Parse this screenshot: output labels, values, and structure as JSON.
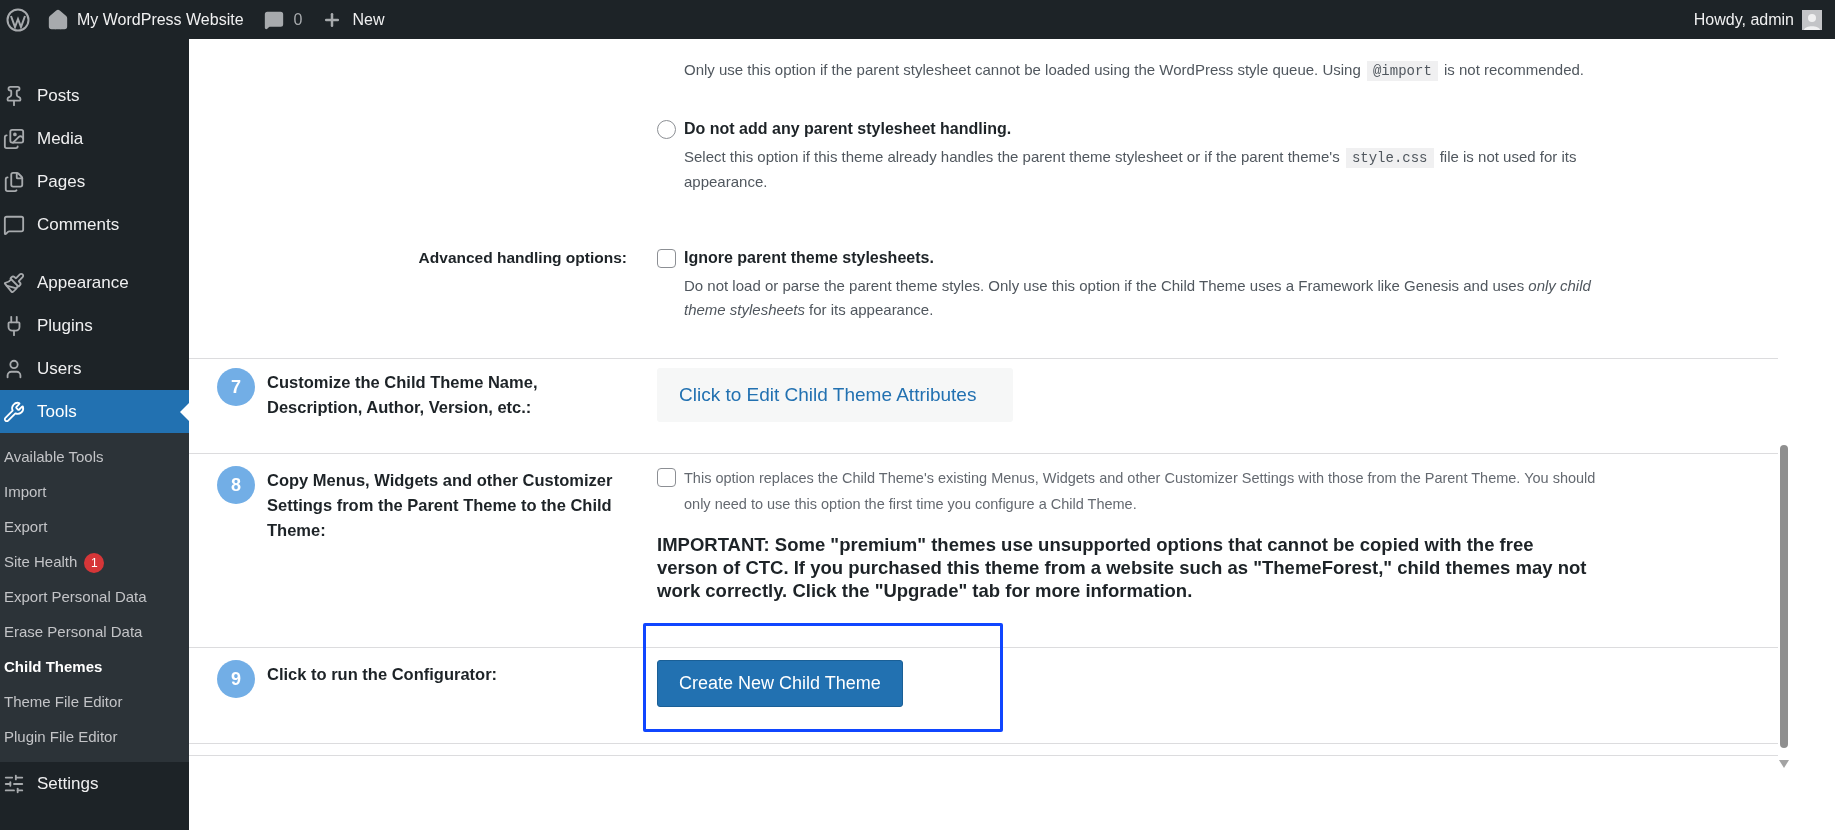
{
  "admin_bar": {
    "site_name": "My WordPress Website",
    "comments_count": "0",
    "new_label": "New",
    "greeting": "Howdy, admin"
  },
  "sidebar": {
    "items": [
      {
        "label": "Posts",
        "selected": false
      },
      {
        "label": "Media",
        "selected": false
      },
      {
        "label": "Pages",
        "selected": false
      },
      {
        "label": "Comments",
        "selected": false
      },
      {
        "label": "Appearance",
        "selected": false
      },
      {
        "label": "Plugins",
        "selected": false
      },
      {
        "label": "Users",
        "selected": false
      },
      {
        "label": "Tools",
        "selected": true,
        "children": [
          {
            "label": "Available Tools",
            "selected": false
          },
          {
            "label": "Import",
            "selected": false
          },
          {
            "label": "Export",
            "selected": false
          },
          {
            "label": "Site Health",
            "selected": false,
            "badge": "1"
          },
          {
            "label": "Export Personal Data",
            "selected": false
          },
          {
            "label": "Erase Personal Data",
            "selected": false
          },
          {
            "label": "Child Themes",
            "selected": true
          },
          {
            "label": "Theme File Editor",
            "selected": false
          },
          {
            "label": "Plugin File Editor",
            "selected": false
          }
        ]
      },
      {
        "label": "Settings",
        "selected": false
      }
    ]
  },
  "import_description": [
    {
      "kind": "text",
      "text": "Only use this option if the parent stylesheet cannot be loaded using the WordPress style queue. Using "
    },
    {
      "kind": "code",
      "text": "@import"
    },
    {
      "kind": "text",
      "text": " is not recommended."
    }
  ],
  "stylesheet_options": [
    {
      "kind": "radio",
      "selected": false,
      "label": [
        {
          "kind": "text",
          "text": "Do not add any parent stylesheet handling."
        }
      ],
      "description": [
        {
          "kind": "text",
          "text": "Select this option if this theme already handles the parent theme stylesheet or if the parent theme's "
        },
        {
          "kind": "code",
          "text": "style.css"
        },
        {
          "kind": "text",
          "text": " file is not used for its appearance."
        }
      ]
    }
  ],
  "advanced": {
    "label": "Advanced handling options:",
    "option": {
      "kind": "checkbox",
      "checked": false,
      "label": [
        {
          "kind": "text",
          "text": "Ignore parent theme stylesheets."
        }
      ],
      "description": [
        {
          "kind": "text",
          "text": "Do not load or parse the parent theme styles. Only use this option if the Child Theme uses a Framework like Genesis and uses *only child theme stylesheets* for its appearance."
        }
      ]
    }
  },
  "steps": [
    {
      "number": "7",
      "label": "Customize the Child Theme Name, Description, Author, Version, etc.:",
      "kind": "dropdown",
      "control": "Click to Edit Child Theme Attributes",
      "highlighted": false
    },
    {
      "number": "8",
      "label": "Copy Menus, Widgets and other Customizer Settings from the Parent Theme to the Child Theme:",
      "kind": "checkbox",
      "checked": false,
      "control": "This option replaces the Child Theme's existing Menus, Widgets and other Customizer Settings with those from the Parent Theme. You should only need to use this option the first time you configure a Child Theme.",
      "notice": "IMPORTANT: Some \"premium\" themes use unsupported options that cannot be copied with the free verson of CTC. If you purchased this theme from a website such as \"ThemeForest,\" child themes may not work correctly. Click the \"Upgrade\" tab for more information.",
      "highlighted": false
    },
    {
      "number": "9",
      "label": "Click to run the Configurator:",
      "kind": "button",
      "control": "Create New Child Theme",
      "highlighted": true
    }
  ]
}
